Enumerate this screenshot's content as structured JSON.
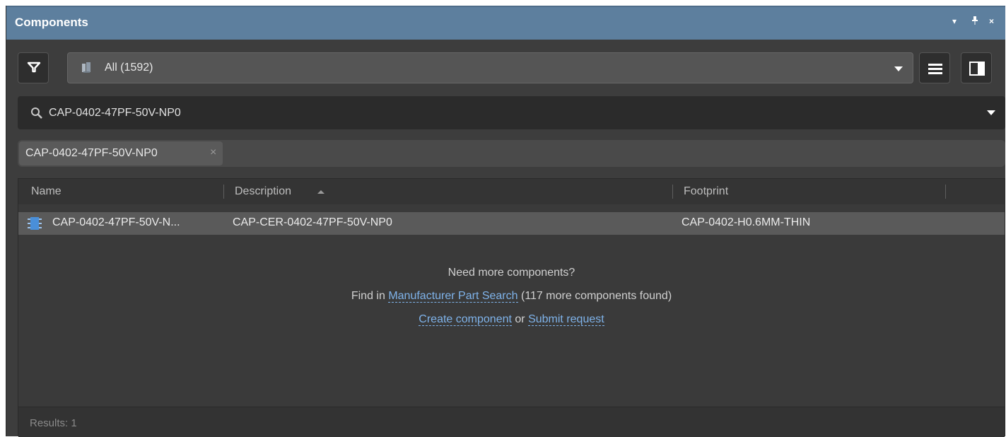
{
  "panel": {
    "title": "Components",
    "controls": {
      "menu": "▾",
      "pin": "ᵽ",
      "close": "×"
    }
  },
  "toolbar": {
    "filter_icon": "filter-icon",
    "library_combo": {
      "value": "All  (1592)",
      "icon": "library-icon"
    },
    "view_list_icon": "list-view-icon",
    "view_split_icon": "split-view-icon"
  },
  "search": {
    "icon": "search-icon",
    "value": "CAP-0402-47PF-50V-NP0"
  },
  "filter_chips": [
    {
      "label": "CAP-0402-47PF-50V-NP0",
      "remove": "×"
    }
  ],
  "grid": {
    "columns": [
      {
        "label": "Name"
      },
      {
        "label": "Description",
        "sorted": "ascending"
      },
      {
        "label": "Footprint"
      }
    ],
    "rows": [
      {
        "icon": "component-icon",
        "name": "CAP-0402-47PF-50V-N...",
        "description": "CAP-CER-0402-47PF-50V-NP0",
        "footprint": "CAP-0402-H0.6MM-THIN"
      }
    ]
  },
  "empty_state": {
    "heading": "Need more components?",
    "line2_prefix": "Find in",
    "manufacturer_link": "Manufacturer Part Search",
    "line2_suffix": "(117 more components found)",
    "create_link": "Create component",
    "or_text": "or",
    "submit_link": "Submit request"
  },
  "status": {
    "results": "Results: 1"
  },
  "colors": {
    "titlebar": "#5d7f9e",
    "panel_bg": "#3d3d3d",
    "link": "#7fb3ea",
    "selected_row": "#5a5a5a"
  }
}
